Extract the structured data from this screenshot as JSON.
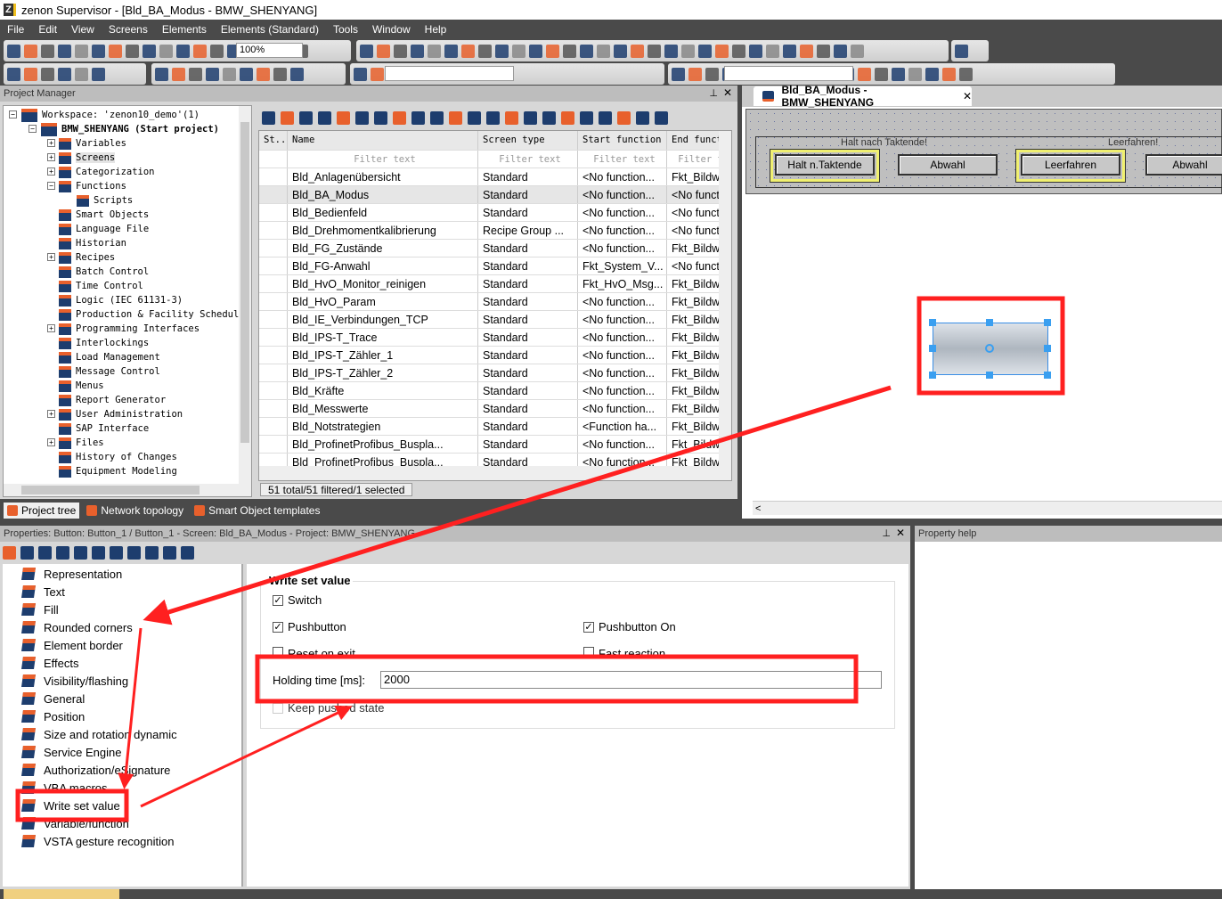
{
  "app": {
    "title": "zenon Supervisor - [Bld_BA_Modus - BMW_SHENYANG]",
    "logo": "Z"
  },
  "menu": [
    "File",
    "Edit",
    "View",
    "Screens",
    "Elements",
    "Elements (Standard)",
    "Tools",
    "Window",
    "Help"
  ],
  "toolbar": {
    "zoom": "100%",
    "search_value": "",
    "filter_value": ""
  },
  "project_manager": {
    "title": "Project Manager",
    "workspace": "Workspace: 'zenon10_demo'(1)",
    "project": "BMW_SHENYANG (Start project)",
    "items": [
      {
        "label": "Variables",
        "expand": "+"
      },
      {
        "label": "Screens",
        "expand": "+",
        "selected": true
      },
      {
        "label": "Categorization",
        "expand": "+"
      },
      {
        "label": "Functions",
        "expand": "-"
      },
      {
        "label": "Scripts",
        "child": true
      },
      {
        "label": "Smart Objects"
      },
      {
        "label": "Language File"
      },
      {
        "label": "Historian"
      },
      {
        "label": "Recipes",
        "expand": "+"
      },
      {
        "label": "Batch Control"
      },
      {
        "label": "Time Control"
      },
      {
        "label": "Logic (IEC 61131-3)"
      },
      {
        "label": "Production & Facility Schedule"
      },
      {
        "label": "Programming Interfaces",
        "expand": "+"
      },
      {
        "label": "Interlockings"
      },
      {
        "label": "Load Management"
      },
      {
        "label": "Message Control"
      },
      {
        "label": "Menus"
      },
      {
        "label": "Report Generator"
      },
      {
        "label": "User Administration",
        "expand": "+"
      },
      {
        "label": "SAP Interface"
      },
      {
        "label": "Files",
        "expand": "+"
      },
      {
        "label": "History of Changes"
      },
      {
        "label": "Equipment Modeling"
      }
    ],
    "grid": {
      "columns": [
        "St...",
        "Name",
        "Screen type",
        "Start function",
        "End function"
      ],
      "filter_placeholder": "Filter text",
      "rows": [
        [
          "",
          "Bld_Anlagenübersicht",
          "Standard",
          "<No function...",
          "Fkt_Bildwechs."
        ],
        [
          "",
          "Bld_BA_Modus",
          "Standard",
          "<No function...",
          "<No function.."
        ],
        [
          "",
          "Bld_Bedienfeld",
          "Standard",
          "<No function...",
          "<No function.."
        ],
        [
          "",
          "Bld_Drehmomentkalibrierung",
          "Recipe Group ...",
          "<No function...",
          "<No function.."
        ],
        [
          "",
          "Bld_FG_Zustände",
          "Standard",
          "<No function...",
          "Fkt_Bildwechs."
        ],
        [
          "",
          "Bld_FG-Anwahl",
          "Standard",
          "Fkt_System_V...",
          "<No function.."
        ],
        [
          "",
          "Bld_HvO_Monitor_reinigen",
          "Standard",
          "Fkt_HvO_Msg...",
          "Fkt_Bildwechs."
        ],
        [
          "",
          "Bld_HvO_Param",
          "Standard",
          "<No function...",
          "Fkt_Bildwechs."
        ],
        [
          "",
          "Bld_IE_Verbindungen_TCP",
          "Standard",
          "<No function...",
          "Fkt_Bildwechs."
        ],
        [
          "",
          "Bld_IPS-T_Trace",
          "Standard",
          "<No function...",
          "Fkt_Bildwechs."
        ],
        [
          "",
          "Bld_IPS-T_Zähler_1",
          "Standard",
          "<No function...",
          "Fkt_Bildwechs."
        ],
        [
          "",
          "Bld_IPS-T_Zähler_2",
          "Standard",
          "<No function...",
          "Fkt_Bildwechs."
        ],
        [
          "",
          "Bld_Kräfte",
          "Standard",
          "<No function...",
          "Fkt_Bildwechs."
        ],
        [
          "",
          "Bld_Messwerte",
          "Standard",
          "<No function...",
          "Fkt_Bildwechs."
        ],
        [
          "",
          "Bld_Notstrategien",
          "Standard",
          "<Function ha...",
          "Fkt_Bildwechs."
        ],
        [
          "",
          "Bld_ProfinetProfibus_Buspla...",
          "Standard",
          "<No function...",
          "Fkt_Bildwechs."
        ],
        [
          "",
          "Bld_ProfinetProfibus_Buspla...",
          "Standard",
          "<No function...",
          "Fkt_Bildwechs."
        ]
      ],
      "selected_row": 1,
      "status": "51 total/51 filtered/1 selected"
    },
    "tabs": [
      "Project tree",
      "Network topology",
      "Smart Object templates"
    ]
  },
  "editor": {
    "tab": "Bld_BA_Modus - BMW_SHENYANG",
    "groups": [
      "Halt nach Taktende!",
      "Leerfahren!"
    ],
    "buttons": [
      "Halt n.Taktende",
      "Abwahl",
      "Leerfahren",
      "Abwahl"
    ]
  },
  "properties": {
    "title": "Properties: Button: Button_1 / Button_1 - Screen: Bld_BA_Modus - Project: BMW_SHENYANG",
    "groups": [
      "Representation",
      "Text",
      "Fill",
      "Rounded corners",
      "Element border",
      "Effects",
      "Visibility/flashing",
      "General",
      "Position",
      "Size and rotation dynamic",
      "Service Engine",
      "Authorization/eSignature",
      "VBA macros",
      "Write set value",
      "Variable/function",
      "VSTA gesture recognition"
    ],
    "selected_group": "Write set value",
    "section_title": "Write set value",
    "switch": {
      "label": "Switch",
      "checked": true
    },
    "pushbutton": {
      "label": "Pushbutton",
      "checked": true
    },
    "pushbutton_on": {
      "label": "Pushbutton On",
      "checked": true
    },
    "reset_on_exit": {
      "label": "Reset on exit",
      "checked": false
    },
    "fast_reaction": {
      "label": "Fast reaction",
      "checked": false
    },
    "holding_time_label": "Holding time [ms]:",
    "holding_time_value": "2000",
    "keep_pushed": {
      "label": "Keep pushed state",
      "checked": false
    }
  },
  "property_help": {
    "title": "Property help"
  },
  "colors": {
    "annotation": "#ff2020",
    "accent": "#e8602c",
    "icon": "#1d3d6e",
    "highlight": "#f0f070"
  }
}
